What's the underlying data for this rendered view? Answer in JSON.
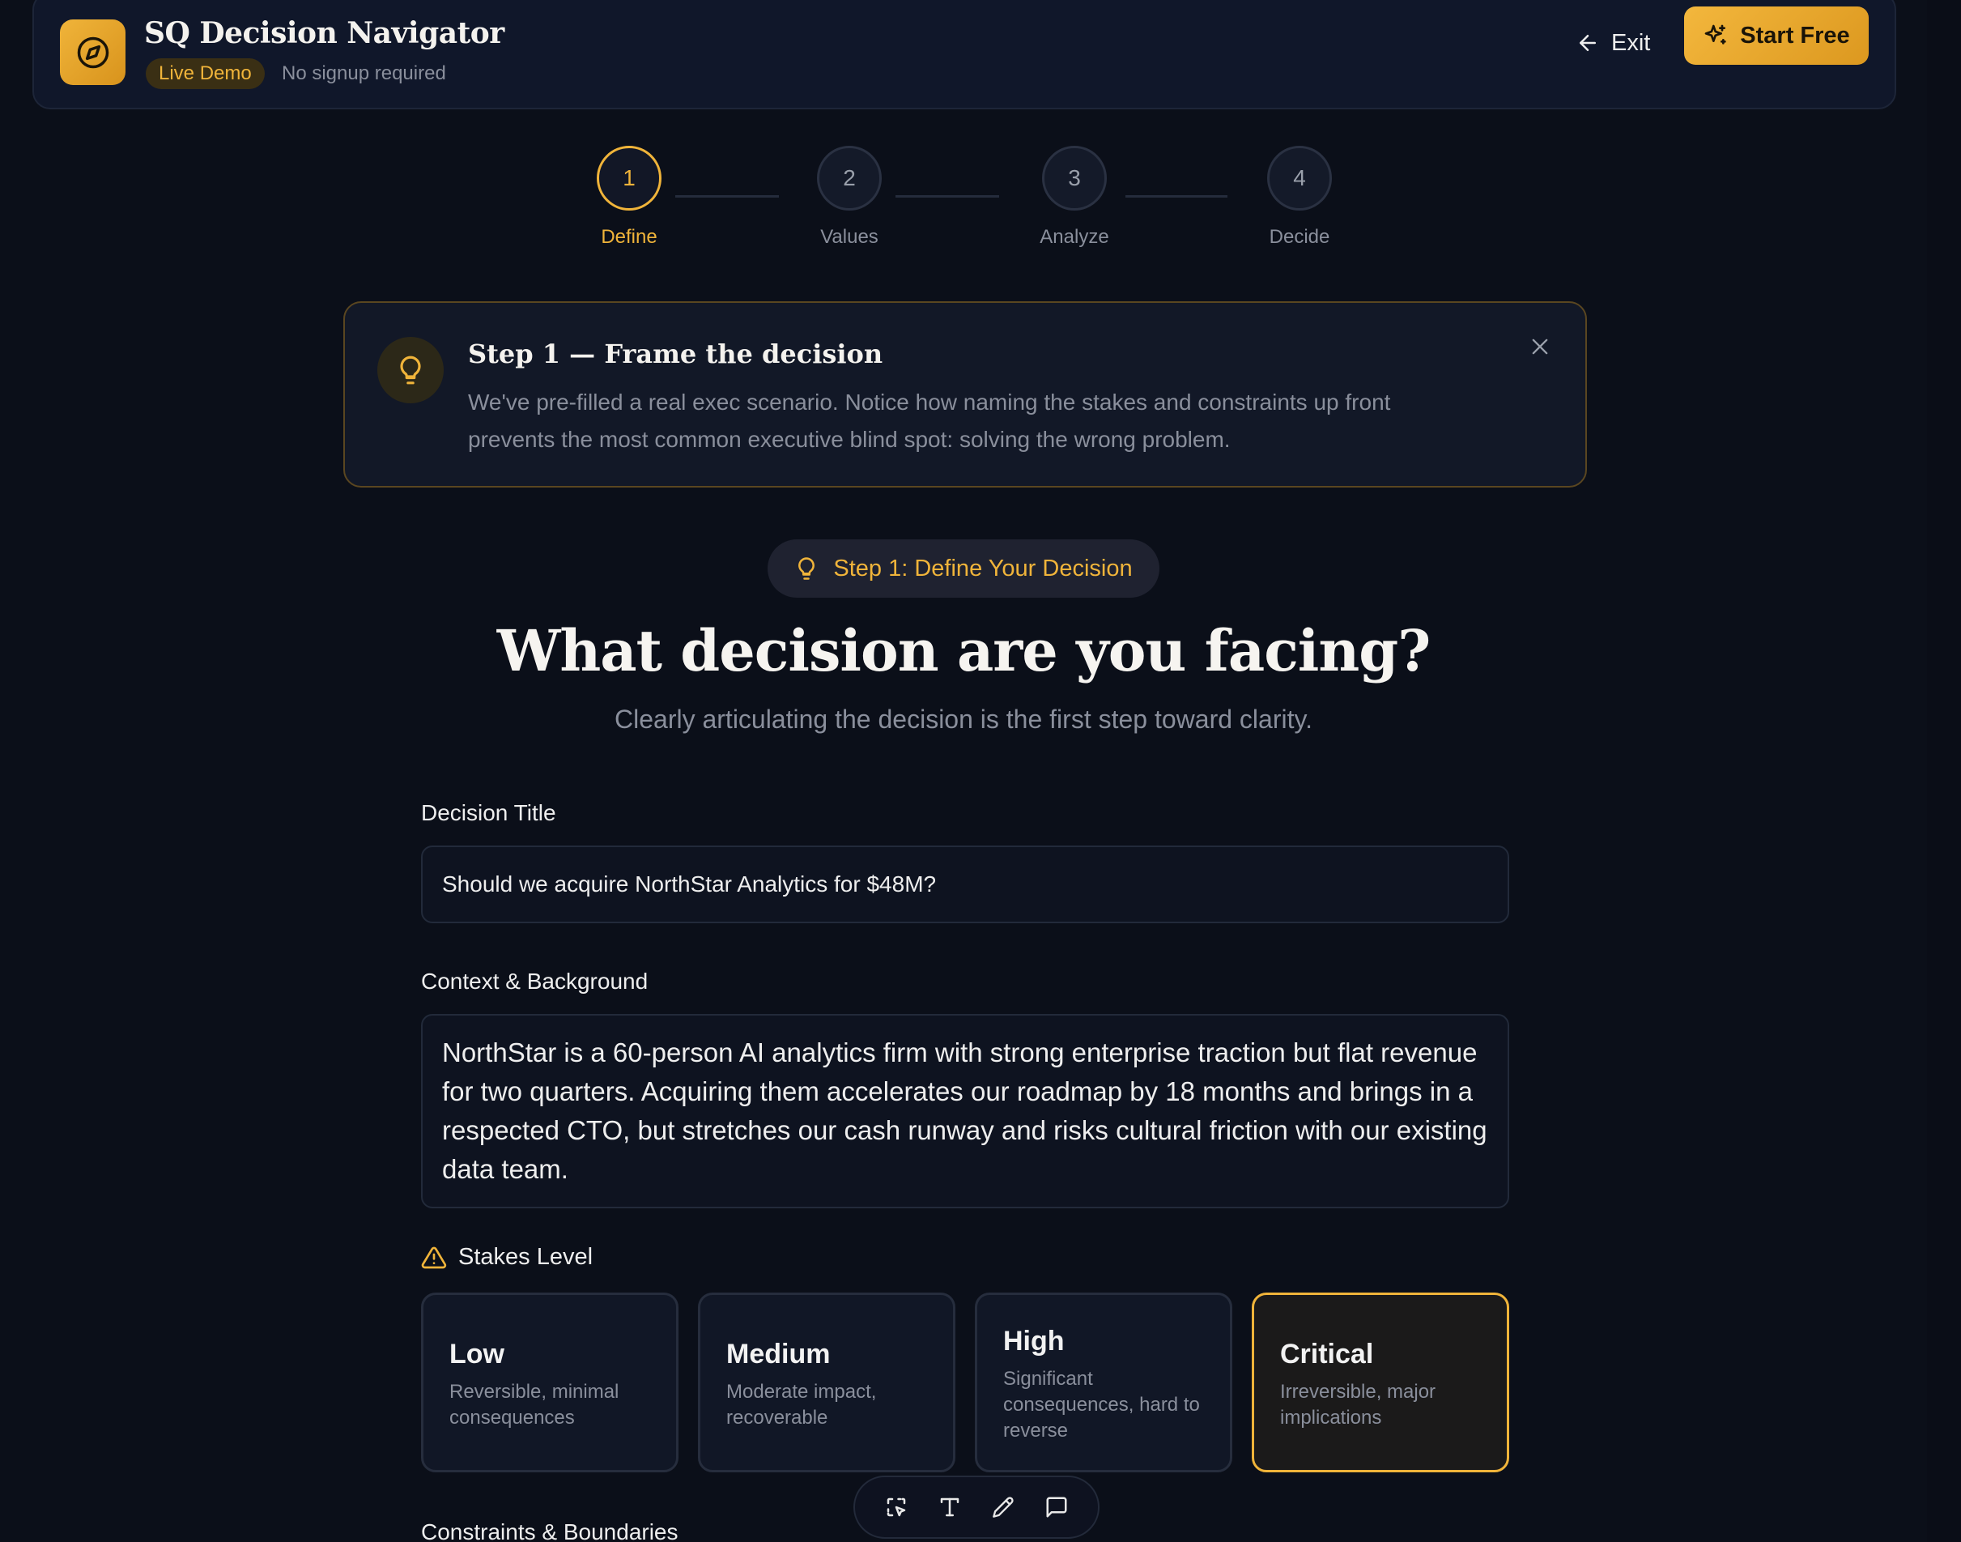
{
  "header": {
    "app_title": "SQ Decision Navigator",
    "badge": "Live Demo",
    "subtitle": "No signup required",
    "exit_label": "Exit",
    "cta_label": "Start Free"
  },
  "stepper": {
    "current": 1,
    "steps": [
      {
        "number": "1",
        "label": "Define"
      },
      {
        "number": "2",
        "label": "Values"
      },
      {
        "number": "3",
        "label": "Analyze"
      },
      {
        "number": "4",
        "label": "Decide"
      }
    ]
  },
  "tip": {
    "title": "Step 1 — Frame the decision",
    "body": "We've pre-filled a real exec scenario. Notice how naming the stakes and constraints up front prevents the most common executive blind spot: solving the wrong problem."
  },
  "step_pill": "Step 1: Define Your Decision",
  "heading": "What decision are you facing?",
  "subheading": "Clearly articulating the decision is the first step toward clarity.",
  "form": {
    "title_label": "Decision Title",
    "title_value": "Should we acquire NorthStar Analytics for $48M?",
    "context_label": "Context & Background",
    "context_value": "NorthStar is a 60-person AI analytics firm with strong enterprise traction but flat revenue for two quarters. Acquiring them accelerates our roadmap by 18 months and brings in a respected CTO, but stretches our cash runway and risks cultural friction with our existing data team.",
    "stakes_label": "Stakes Level",
    "stakes_selected": "Critical",
    "stakes": [
      {
        "name": "Low",
        "desc": "Reversible, minimal consequences"
      },
      {
        "name": "Medium",
        "desc": "Moderate impact, recoverable"
      },
      {
        "name": "High",
        "desc": "Significant consequences, hard to reverse"
      },
      {
        "name": "Critical",
        "desc": "Irreversible, major implications"
      }
    ],
    "constraints_label": "Constraints & Boundaries"
  },
  "toolbar": {
    "tools": [
      "select-icon",
      "text-icon",
      "pencil-icon",
      "comment-icon"
    ]
  },
  "colors": {
    "accent": "#f0b43a",
    "background": "#0b0f19"
  }
}
